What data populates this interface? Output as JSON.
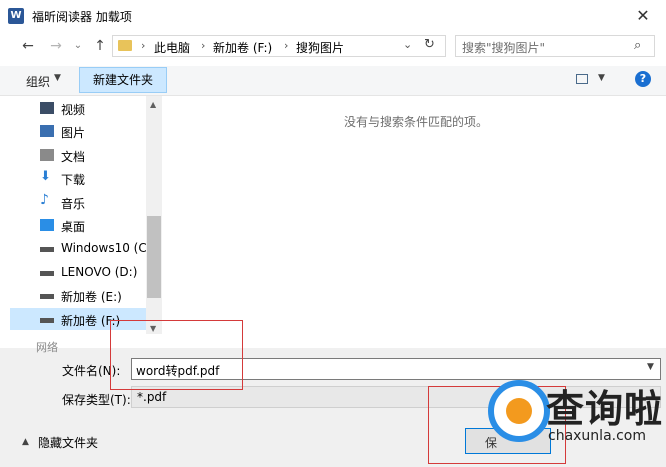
{
  "window": {
    "title": "福昕阅读器 加载项",
    "app_icon": "W",
    "close": "✕"
  },
  "nav": {
    "back": "←",
    "forward": "→",
    "recent": "⌄",
    "up": "↑"
  },
  "address": {
    "crumbs": [
      "此电脑",
      "新加卷 (F:)",
      "搜狗图片"
    ],
    "separator": "›",
    "dropdown": "⌄",
    "refresh": "↻"
  },
  "search": {
    "placeholder": "搜索\"搜狗图片\"",
    "icon": "⌕"
  },
  "toolbar": {
    "organize": "组织",
    "organize_caret": "▼",
    "new_folder": "新建文件夹",
    "view_caret": "▼",
    "help": "?"
  },
  "sidebar": {
    "items": [
      {
        "label": "视频",
        "icon": "video-icon",
        "color": "#3b4d66"
      },
      {
        "label": "图片",
        "icon": "picture-icon",
        "color": "#3a6fb0"
      },
      {
        "label": "文档",
        "icon": "document-icon",
        "color": "#8a8a8a"
      },
      {
        "label": "下载",
        "icon": "download-icon",
        "color": "#2a7fd4"
      },
      {
        "label": "音乐",
        "icon": "music-icon",
        "color": "#2a7fd4"
      },
      {
        "label": "桌面",
        "icon": "desktop-icon",
        "color": "#2a8ee6"
      },
      {
        "label": "Windows10 (C:",
        "icon": "windows-drive-icon",
        "color": "#555"
      },
      {
        "label": "LENOVO (D:)",
        "icon": "drive-icon",
        "color": "#555"
      },
      {
        "label": "新加卷 (E:)",
        "icon": "drive-icon",
        "color": "#555"
      },
      {
        "label": "新加卷 (F:)",
        "icon": "drive-icon",
        "color": "#555",
        "selected": true
      }
    ],
    "partial_item": "网络"
  },
  "content": {
    "empty_message": "没有与搜索条件匹配的项。"
  },
  "form": {
    "filename_label": "文件名(N):",
    "filename_value": "word转pdf.pdf",
    "filetype_label": "保存类型(T):",
    "filetype_value": "*.pdf",
    "hide_folders": "隐藏文件夹",
    "hide_caret": "▲",
    "save_label": "保"
  },
  "watermark": {
    "text": "查询啦",
    "url": "chaxunla.com"
  }
}
